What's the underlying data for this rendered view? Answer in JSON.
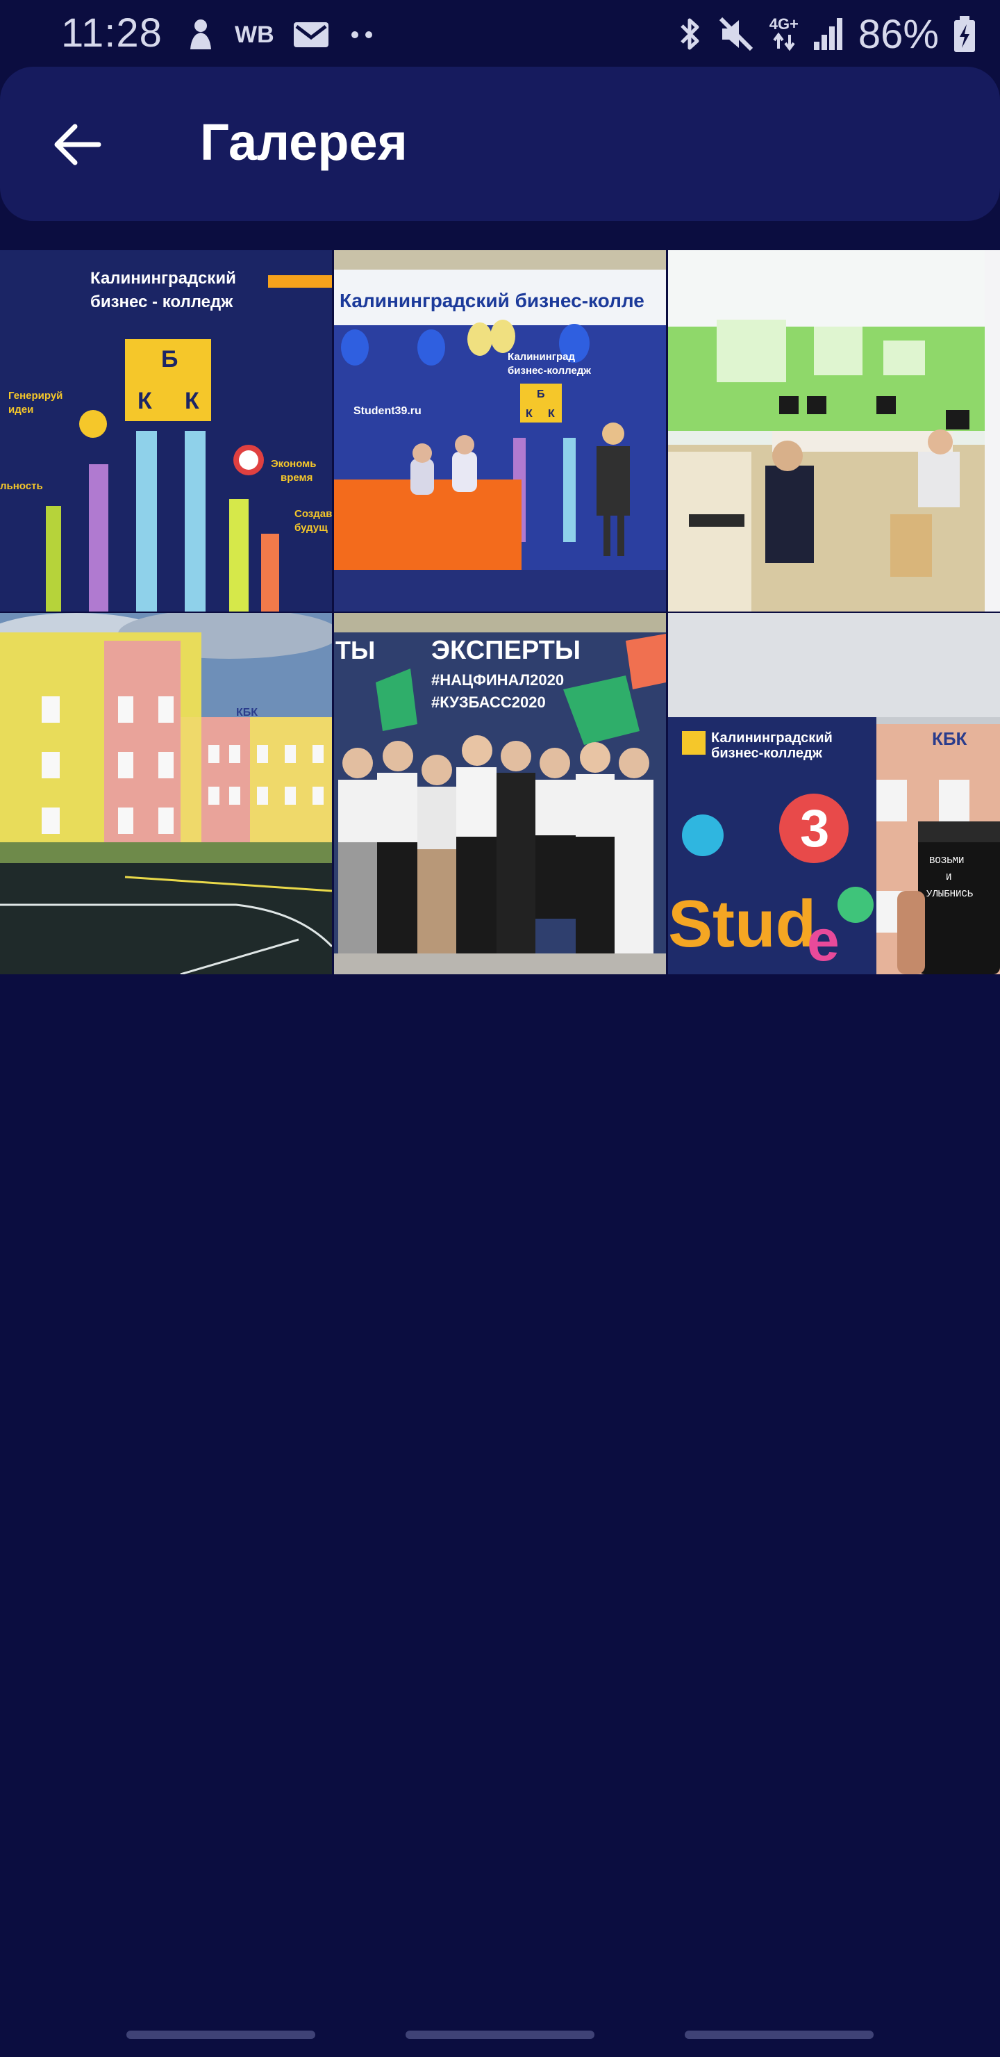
{
  "status_bar": {
    "time": "11:28",
    "left_icons": [
      "notification-figure-icon",
      "wb-icon",
      "mail-icon",
      "more-dots-icon"
    ],
    "wb_label": "WB",
    "network_label": "4G+",
    "right_icons": [
      "bluetooth-icon",
      "mute-icon",
      "network-4g-icon",
      "signal-icon",
      "battery-charging-icon"
    ],
    "battery": "86%"
  },
  "app_bar": {
    "title": "Галерея",
    "back_icon": "arrow-left-icon"
  },
  "gallery": {
    "items": [
      {
        "kind": "college-poster",
        "texts": [
          "Калининградский",
          "бизнес - колледж",
          "Б",
          "К",
          "К",
          "Генерируй",
          "идеи",
          "Экономь",
          "время",
          "Создавай",
          "будущ",
          "льность"
        ]
      },
      {
        "kind": "expo-stand",
        "texts": [
          "Калининградский бизнес-колле",
          "Калининград",
          "бизнес-колледж",
          "Б",
          "К",
          "К",
          "Student39.ru"
        ]
      },
      {
        "kind": "computer-classroom",
        "texts": []
      },
      {
        "kind": "college-building",
        "texts": [
          "КБК"
        ]
      },
      {
        "kind": "experts-group-photo",
        "texts": [
          "ТЫ",
          "ЭКСПЕРТЫ",
          "#НАЦФИНАЛ2020",
          "#КУЗБАСС2020"
        ]
      },
      {
        "kind": "student-poster-coffee",
        "texts": [
          "Калининградский",
          "бизнес-колледж",
          "КБК",
          "3",
          "Stud",
          "e",
          "ВОЗЬМИ",
          "И",
          "УЛЫБНИСЬ"
        ]
      }
    ]
  },
  "colors": {
    "background": "#0b0d40",
    "app_bar": "#161b5e",
    "text": "#ffffff",
    "status_text": "#d7d9ec"
  }
}
